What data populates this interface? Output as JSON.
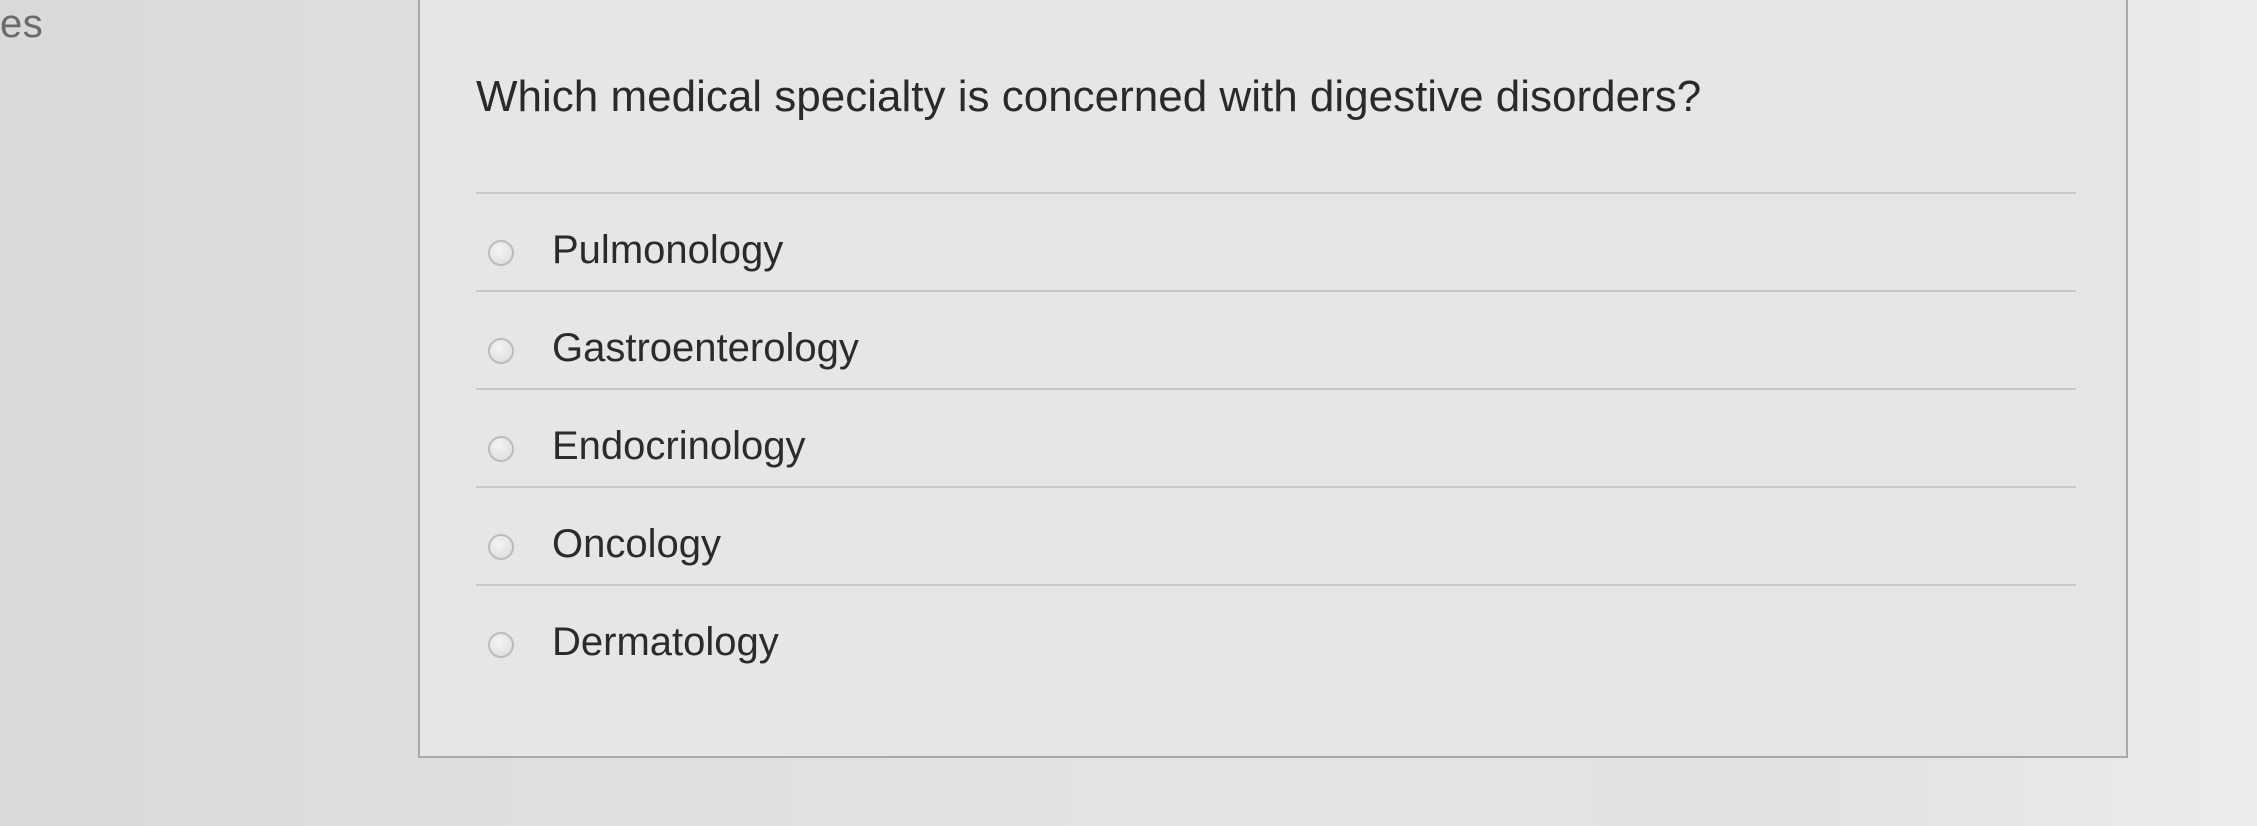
{
  "page": {
    "left_fragment": "es"
  },
  "question": {
    "text": "Which medical specialty is concerned with digestive disorders?",
    "options": [
      {
        "label": "Pulmonology",
        "selected": false
      },
      {
        "label": "Gastroenterology",
        "selected": false
      },
      {
        "label": "Endocrinology",
        "selected": false
      },
      {
        "label": "Oncology",
        "selected": false
      },
      {
        "label": "Dermatology",
        "selected": false
      }
    ]
  },
  "colors": {
    "background": "#e0e0e0",
    "card_border": "#a9a9a9",
    "divider": "#c9c9c9",
    "text": "#2b2b2b"
  }
}
